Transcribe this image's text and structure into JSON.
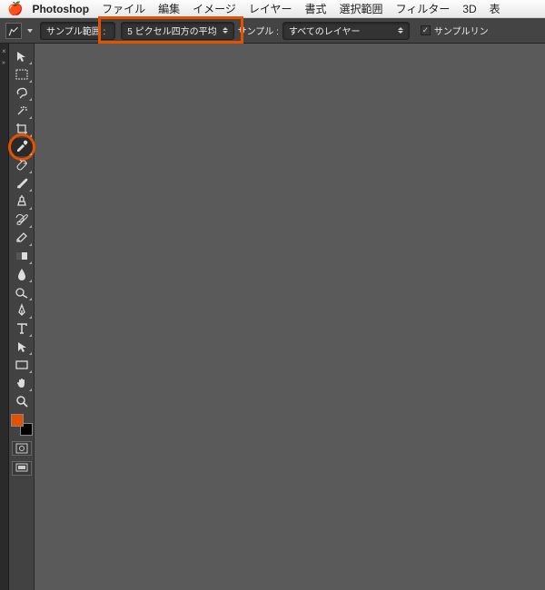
{
  "menubar": {
    "items": [
      "Photoshop",
      "ファイル",
      "編集",
      "イメージ",
      "レイヤー",
      "書式",
      "選択範囲",
      "フィルター",
      "3D",
      "表"
    ]
  },
  "options": {
    "sample_range_label": "サンプル範囲 :",
    "sample_range_value": "5 ピクセル四方の平均",
    "sample_label": "サンプル :",
    "sample_value": "すべてのレイヤー",
    "sample_ring_label": "サンプルリン"
  },
  "tools": [
    {
      "name": "move-tool",
      "flyout": true
    },
    {
      "name": "rectangular-marquee-tool",
      "flyout": true
    },
    {
      "name": "lasso-tool",
      "flyout": true
    },
    {
      "name": "magic-wand-tool",
      "flyout": true
    },
    {
      "name": "crop-tool",
      "flyout": true
    },
    {
      "name": "eyedropper-tool",
      "flyout": true,
      "selected": true,
      "highlighted": true
    },
    {
      "name": "spot-healing-brush-tool",
      "flyout": true
    },
    {
      "name": "brush-tool",
      "flyout": true
    },
    {
      "name": "clone-stamp-tool",
      "flyout": true
    },
    {
      "name": "history-brush-tool",
      "flyout": true
    },
    {
      "name": "eraser-tool",
      "flyout": true
    },
    {
      "name": "gradient-tool",
      "flyout": true
    },
    {
      "name": "blur-tool",
      "flyout": true
    },
    {
      "name": "dodge-tool",
      "flyout": true
    },
    {
      "name": "pen-tool",
      "flyout": true
    },
    {
      "name": "type-tool",
      "flyout": true
    },
    {
      "name": "path-selection-tool",
      "flyout": true
    },
    {
      "name": "rectangle-tool",
      "flyout": true
    },
    {
      "name": "hand-tool",
      "flyout": true
    },
    {
      "name": "zoom-tool",
      "flyout": false
    }
  ],
  "colors": {
    "foreground": "#e65100",
    "background": "#000000"
  }
}
